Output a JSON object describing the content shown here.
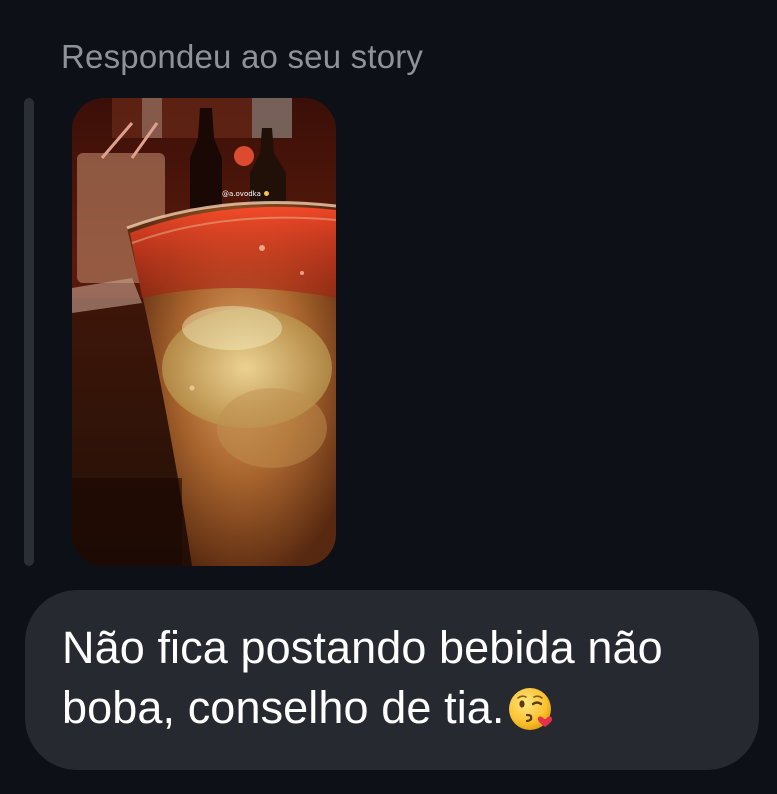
{
  "reply": {
    "caption": "Respondeu ao seu story"
  },
  "story": {
    "tag": "@a.ovodka"
  },
  "message": {
    "text": "Não fica postando bebida não boba, conselho de tia.",
    "emoji": "kissing-face-with-heart-emoji"
  },
  "colors": {
    "background": "#0d1016",
    "bubble": "#262a30",
    "caption": "#8e9299",
    "message_text": "#ffffff"
  }
}
